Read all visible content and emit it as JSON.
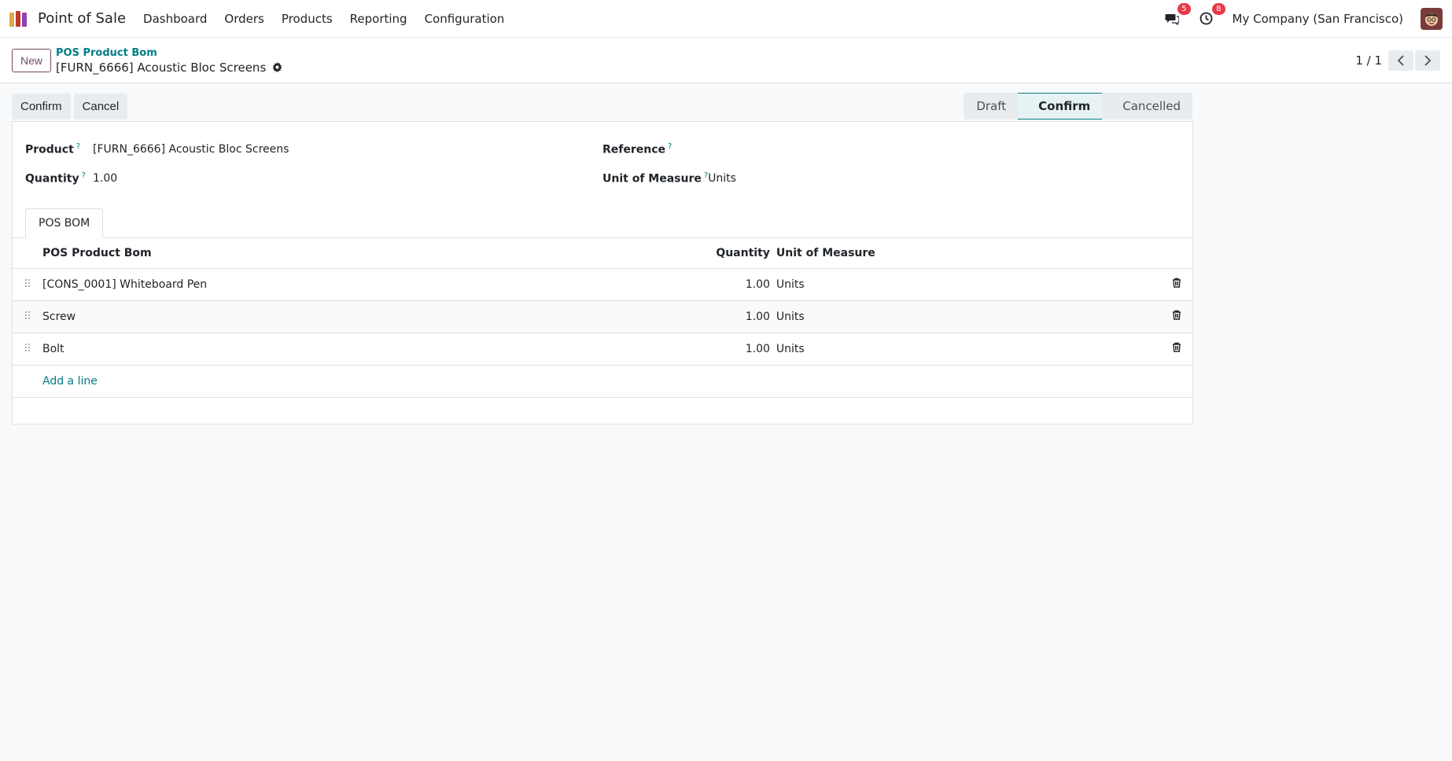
{
  "navbar": {
    "app_name": "Point of Sale",
    "menu": [
      "Dashboard",
      "Orders",
      "Products",
      "Reporting",
      "Configuration"
    ],
    "messages_count": "5",
    "activities_count": "8",
    "company": "My Company (San Francisco)"
  },
  "control": {
    "new_label": "New",
    "breadcrumb_parent": "POS Product Bom",
    "breadcrumb_current": "[FURN_6666] Acoustic Bloc Screens",
    "pager": "1 / 1"
  },
  "actions": {
    "confirm_label": "Confirm",
    "cancel_label": "Cancel"
  },
  "status": {
    "steps": [
      "Draft",
      "Confirm",
      "Cancelled"
    ],
    "active": "Confirm"
  },
  "form": {
    "product_label": "Product",
    "product_value": "[FURN_6666] Acoustic Bloc Screens",
    "quantity_label": "Quantity",
    "quantity_value": "1.00",
    "reference_label": "Reference",
    "reference_value": "",
    "uom_label": "Unit of Measure",
    "uom_value": "Units",
    "help_mark": "?"
  },
  "tabs": [
    "POS BOM"
  ],
  "bom_table": {
    "headers": [
      "POS Product Bom",
      "Quantity",
      "Unit of Measure"
    ],
    "rows": [
      {
        "product": "[CONS_0001] Whiteboard Pen",
        "qty": "1.00",
        "uom": "Units"
      },
      {
        "product": "Screw",
        "qty": "1.00",
        "uom": "Units"
      },
      {
        "product": "Bolt",
        "qty": "1.00",
        "uom": "Units"
      }
    ],
    "add_line_label": "Add a line"
  },
  "colors": {
    "brand": "#714b67",
    "accent": "#017e84",
    "badge": "#e63946"
  }
}
